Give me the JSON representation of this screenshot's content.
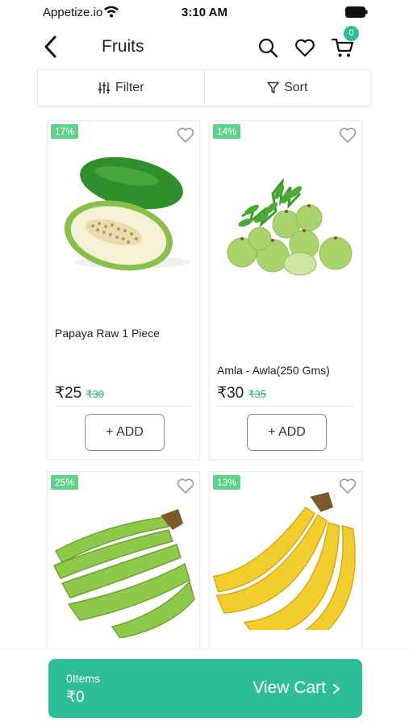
{
  "status_bar": {
    "carrier": "Appetize.io",
    "time": "3:10 AM"
  },
  "header": {
    "title": "Fruits",
    "cart_count": "0"
  },
  "toolbar": {
    "filter_label": "Filter",
    "sort_label": "Sort"
  },
  "products": [
    {
      "discount": "17%",
      "name": "Papaya Raw 1 Piece",
      "price": "₹25",
      "mrp": "₹30",
      "add_label": "+ ADD",
      "image": "papaya-image"
    },
    {
      "discount": "14%",
      "name": "Amla - Awla(250 Gms)",
      "price": "₹30",
      "mrp": "₹35",
      "add_label": "+ ADD",
      "image": "amla-image"
    },
    {
      "discount": "25%",
      "image": "raw-banana-image"
    },
    {
      "discount": "13%",
      "image": "banana-image"
    }
  ],
  "cart_bar": {
    "items": "0Items",
    "total": "₹0",
    "view_cart_label": "View Cart"
  },
  "colors": {
    "accent": "#2dbd97",
    "discount": "#5fd28a",
    "mrp": "#2fb07c"
  }
}
